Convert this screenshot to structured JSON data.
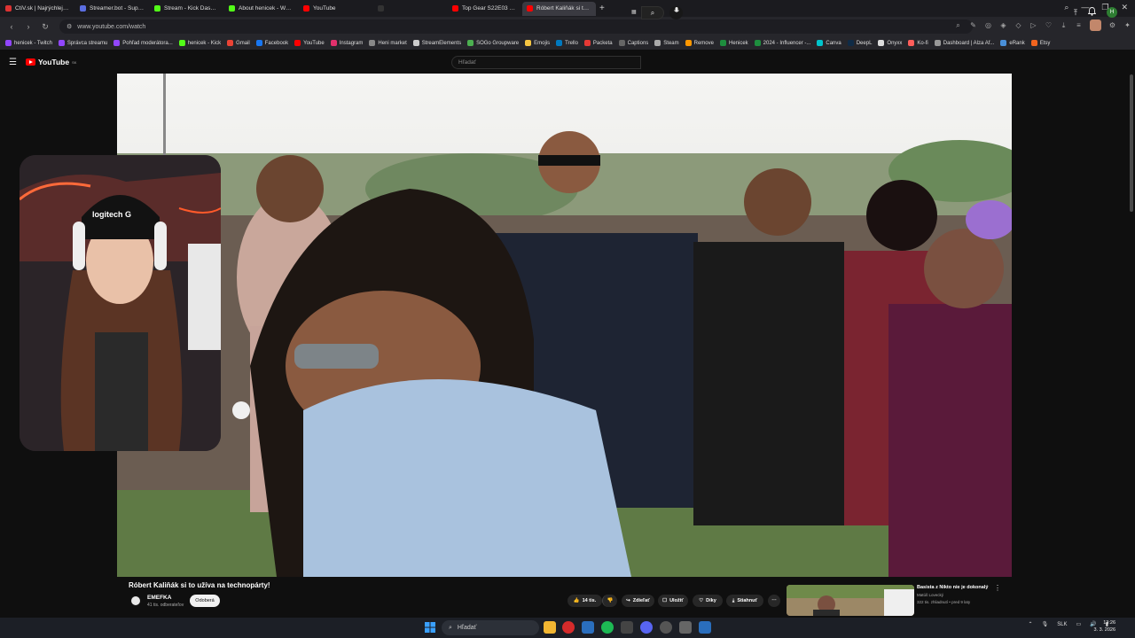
{
  "browser": {
    "tabs": [
      {
        "label": "ČtiV.sk | Najrýchlejší Scre",
        "color": "#d33"
      },
      {
        "label": "Streamer.bot - Superchar",
        "color": "#5b6ee1"
      },
      {
        "label": "Stream - Kick Dashboard",
        "color": "#53fc18"
      },
      {
        "label": "About henicek - Watch Li",
        "color": "#53fc18"
      },
      {
        "label": "YouTube",
        "color": "#ff0000"
      },
      {
        "label": "",
        "color": "#333"
      },
      {
        "label": "Top Gear S22E03 Hammo",
        "color": "#ff0000"
      },
      {
        "label": "Róbert Kaliňák si to uží",
        "color": "#ff0000",
        "active": true
      }
    ],
    "new_tab": "+",
    "url": "www.youtube.com/watch",
    "bookmarks": [
      {
        "label": "henicek - Twitch",
        "color": "#9146ff"
      },
      {
        "label": "Správca streamu",
        "color": "#9146ff"
      },
      {
        "label": "Pohľad moderátora...",
        "color": "#9146ff"
      },
      {
        "label": "henicek - Kick",
        "color": "#53fc18"
      },
      {
        "label": "Gmail",
        "color": "#ea4335"
      },
      {
        "label": "Facebook",
        "color": "#1877f2"
      },
      {
        "label": "YouTube",
        "color": "#ff0000"
      },
      {
        "label": "Instagram",
        "color": "#e1306c"
      },
      {
        "label": "Heni market",
        "color": "#888"
      },
      {
        "label": "StreamElements",
        "color": "#ccc"
      },
      {
        "label": "SOGo Groupware",
        "color": "#4caf50"
      },
      {
        "label": "Emojis",
        "color": "#f5c542"
      },
      {
        "label": "Trello",
        "color": "#0079bf"
      },
      {
        "label": "Packeta",
        "color": "#e53935"
      },
      {
        "label": "Captions",
        "color": "#666"
      },
      {
        "label": "Steam",
        "color": "#aaa"
      },
      {
        "label": "Remove",
        "color": "#ff9800"
      },
      {
        "label": "Henicek",
        "color": "#1e8e3e"
      },
      {
        "label": "2024 - Influencer -...",
        "color": "#1e8e3e"
      },
      {
        "label": "Canva",
        "color": "#00c4cc"
      },
      {
        "label": "DeepL",
        "color": "#0f2b46"
      },
      {
        "label": "Onyxx",
        "color": "#ddd"
      },
      {
        "label": "Ko-fi",
        "color": "#ff5e5b"
      },
      {
        "label": "Dashboard | Alza Af...",
        "color": "#999"
      },
      {
        "label": "eRank",
        "color": "#4a90d9"
      },
      {
        "label": "Etsy",
        "color": "#f1641e"
      }
    ]
  },
  "youtube": {
    "logo_text": "YouTube",
    "logo_sup": "SK",
    "search_placeholder": "Hľadať",
    "avatar_letter": "H",
    "video": {
      "title": "Róbert Kaliňák si to užíva na technopárty!",
      "channel": "EMEFKA",
      "subscribers": "41 tis. odberateľov",
      "unsubscribe_label": "Odoberá",
      "likes": "14 tis.",
      "share_label": "Zdieľať",
      "save_label": "Uložiť",
      "thanks_label": "Díky",
      "download_label": "Stiahnuť",
      "more": "⋯"
    },
    "recommendation": {
      "title": "Basista z Nikto nie je dokonalý",
      "author": "Matúš Lovecký",
      "meta": "322 tis. zhliadnutí • pred 9 laty"
    }
  },
  "taskbar": {
    "search_label": "Hľadať",
    "lang": "SLK",
    "time": "13:26",
    "date": "3. 3. 2026"
  },
  "icons": {
    "menu": "☰",
    "search": "⌕",
    "mic": "🎙",
    "create": "⤒",
    "bell": "🔔",
    "like": "👍",
    "dislike": "👎",
    "share": "↪",
    "save": "☐",
    "thanks": "♡",
    "download": "⤓"
  }
}
